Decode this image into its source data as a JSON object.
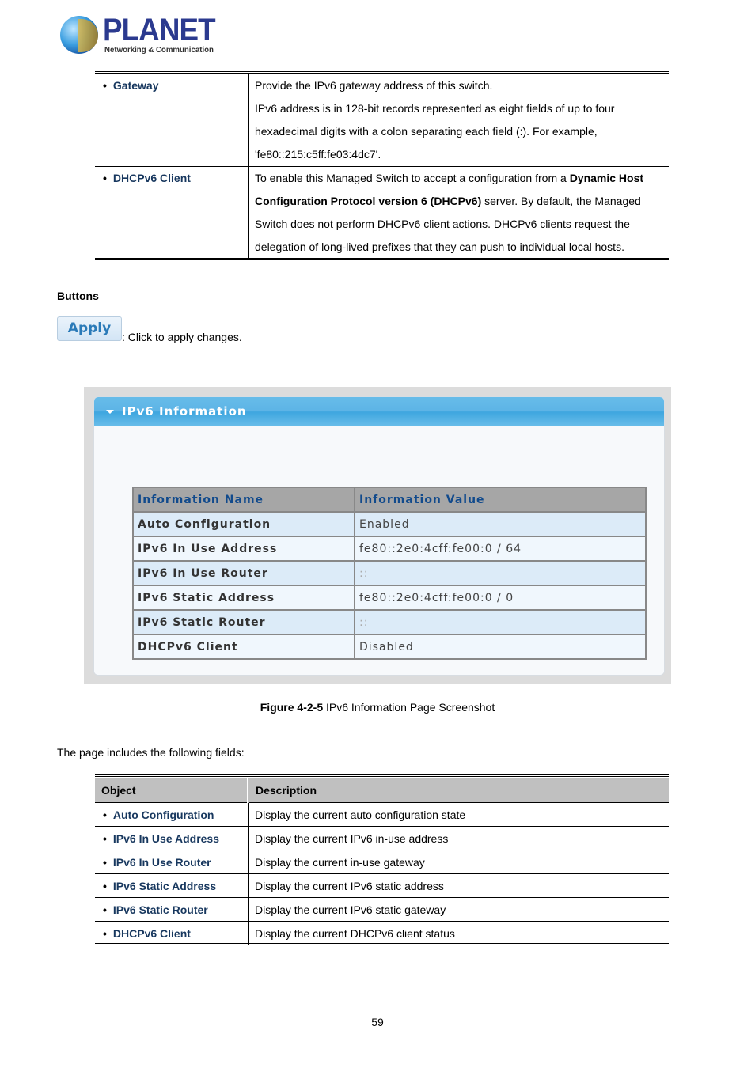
{
  "logo": {
    "brand": "PLANET",
    "tagline": "Networking & Communication"
  },
  "top_table": {
    "rows": [
      {
        "object": "Gateway",
        "lines": [
          "Provide the IPv6 gateway address of this switch.",
          "IPv6 address is in 128-bit records represented as eight fields of up to four",
          "hexadecimal digits with a colon separating each field (:). For example,",
          "'fe80::215:c5ff:fe03:4dc7'."
        ]
      },
      {
        "object": "DHCPv6 Client",
        "line1_pre": "To enable this Managed Switch to accept a configuration from a ",
        "line1_bold": "Dynamic Host",
        "line2_bold": "Configuration Protocol version 6 (DHCPv6)",
        "line2_post": " server. By default, the Managed",
        "line3": "Switch does not perform DHCPv6 client actions. DHCPv6 clients request the",
        "line4": "delegation of long-lived prefixes that they can push to individual local hosts."
      }
    ]
  },
  "buttons_section": {
    "heading": "Buttons",
    "apply_label": "Apply",
    "apply_desc": ": Click to apply changes."
  },
  "screenshot": {
    "panel_title": "IPv6 Information",
    "columns": [
      "Information Name",
      "Information Value"
    ],
    "rows": [
      {
        "name": "Auto Configuration",
        "value": "Enabled"
      },
      {
        "name": "IPv6 In Use Address",
        "value": "fe80::2e0:4cff:fe00:0 / 64"
      },
      {
        "name": "IPv6 In Use Router",
        "value": "::"
      },
      {
        "name": "IPv6 Static Address",
        "value": "fe80::2e0:4cff:fe00:0 / 0"
      },
      {
        "name": "IPv6 Static Router",
        "value": "::"
      },
      {
        "name": "DHCPv6 Client",
        "value": "Disabled"
      }
    ]
  },
  "caption": {
    "label": "Figure 4-2-5",
    "text": " IPv6 Information Page Screenshot"
  },
  "intro": "The page includes the following fields:",
  "fields_table": {
    "columns": [
      "Object",
      "Description"
    ],
    "rows": [
      {
        "object": "Auto Configuration",
        "description": "Display the current auto configuration state"
      },
      {
        "object": "IPv6 In Use Address",
        "description": "Display the current IPv6 in-use address"
      },
      {
        "object": "IPv6 In Use Router",
        "description": "Display the current in-use gateway"
      },
      {
        "object": "IPv6 Static Address",
        "description": "Display the current IPv6 static address"
      },
      {
        "object": "IPv6 Static Router",
        "description": "Display the current IPv6 static gateway"
      },
      {
        "object": "DHCPv6 Client",
        "description": "Display the current DHCPv6 client status"
      }
    ]
  },
  "page_number": "59"
}
